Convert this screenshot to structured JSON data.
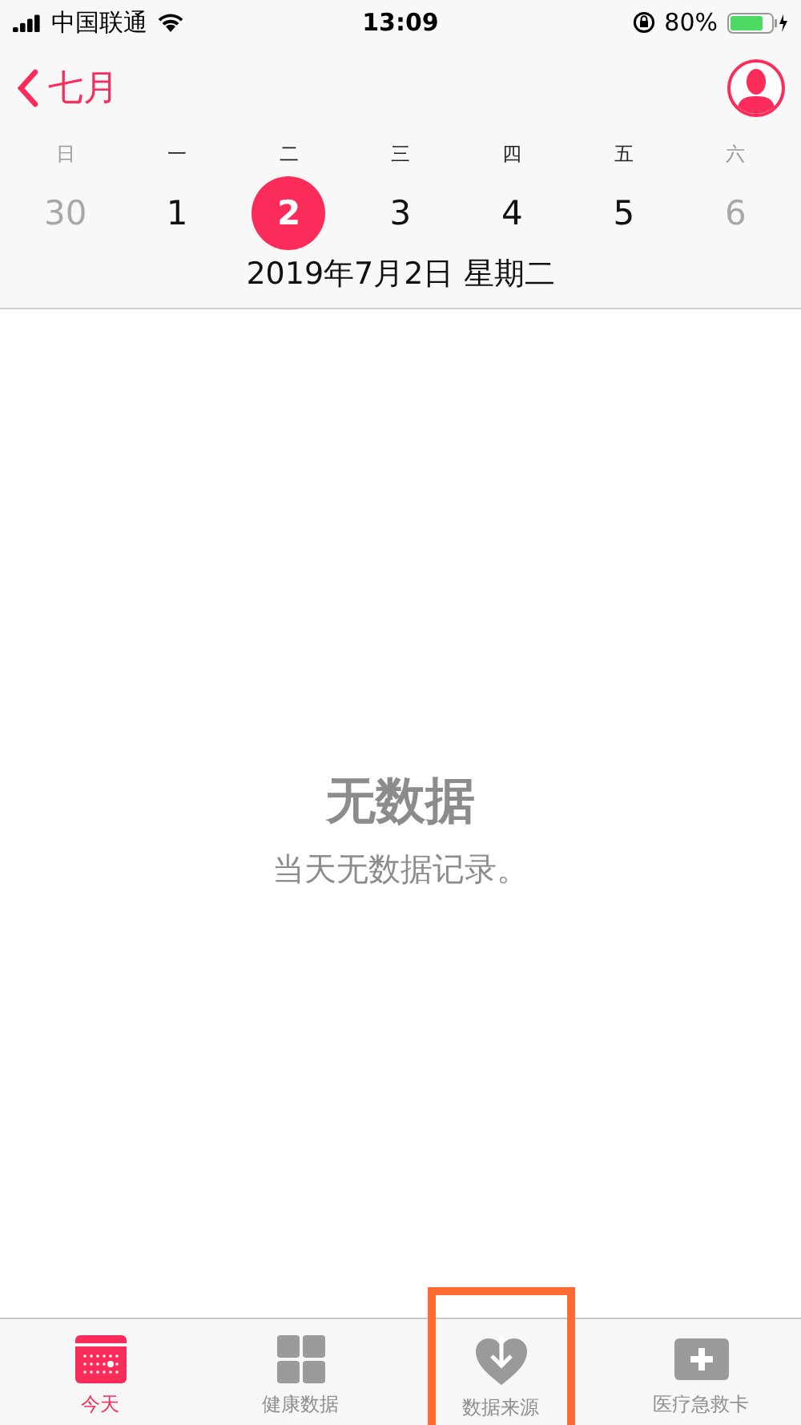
{
  "status_bar": {
    "carrier": "中国联通",
    "time": "13:09",
    "battery_percent": "80%"
  },
  "nav": {
    "back_label": "七月"
  },
  "week": [
    {
      "weekday": "日",
      "date": "30",
      "weekend": true,
      "selected": false
    },
    {
      "weekday": "一",
      "date": "1",
      "weekend": false,
      "selected": false
    },
    {
      "weekday": "二",
      "date": "2",
      "weekend": false,
      "selected": true
    },
    {
      "weekday": "三",
      "date": "3",
      "weekend": false,
      "selected": false
    },
    {
      "weekday": "四",
      "date": "4",
      "weekend": false,
      "selected": false
    },
    {
      "weekday": "五",
      "date": "5",
      "weekend": false,
      "selected": false
    },
    {
      "weekday": "六",
      "date": "6",
      "weekend": true,
      "selected": false
    }
  ],
  "date_title": "2019年7月2日 星期二",
  "empty": {
    "title": "无数据",
    "message": "当天无数据记录。"
  },
  "tabs": [
    {
      "kind": "calendar",
      "label": "今天",
      "selected": true,
      "highlighted": false
    },
    {
      "kind": "grid",
      "label": "健康数据",
      "selected": false,
      "highlighted": false
    },
    {
      "kind": "heart",
      "label": "数据来源",
      "selected": false,
      "highlighted": true
    },
    {
      "kind": "card",
      "label": "医疗急救卡",
      "selected": false,
      "highlighted": false
    }
  ]
}
